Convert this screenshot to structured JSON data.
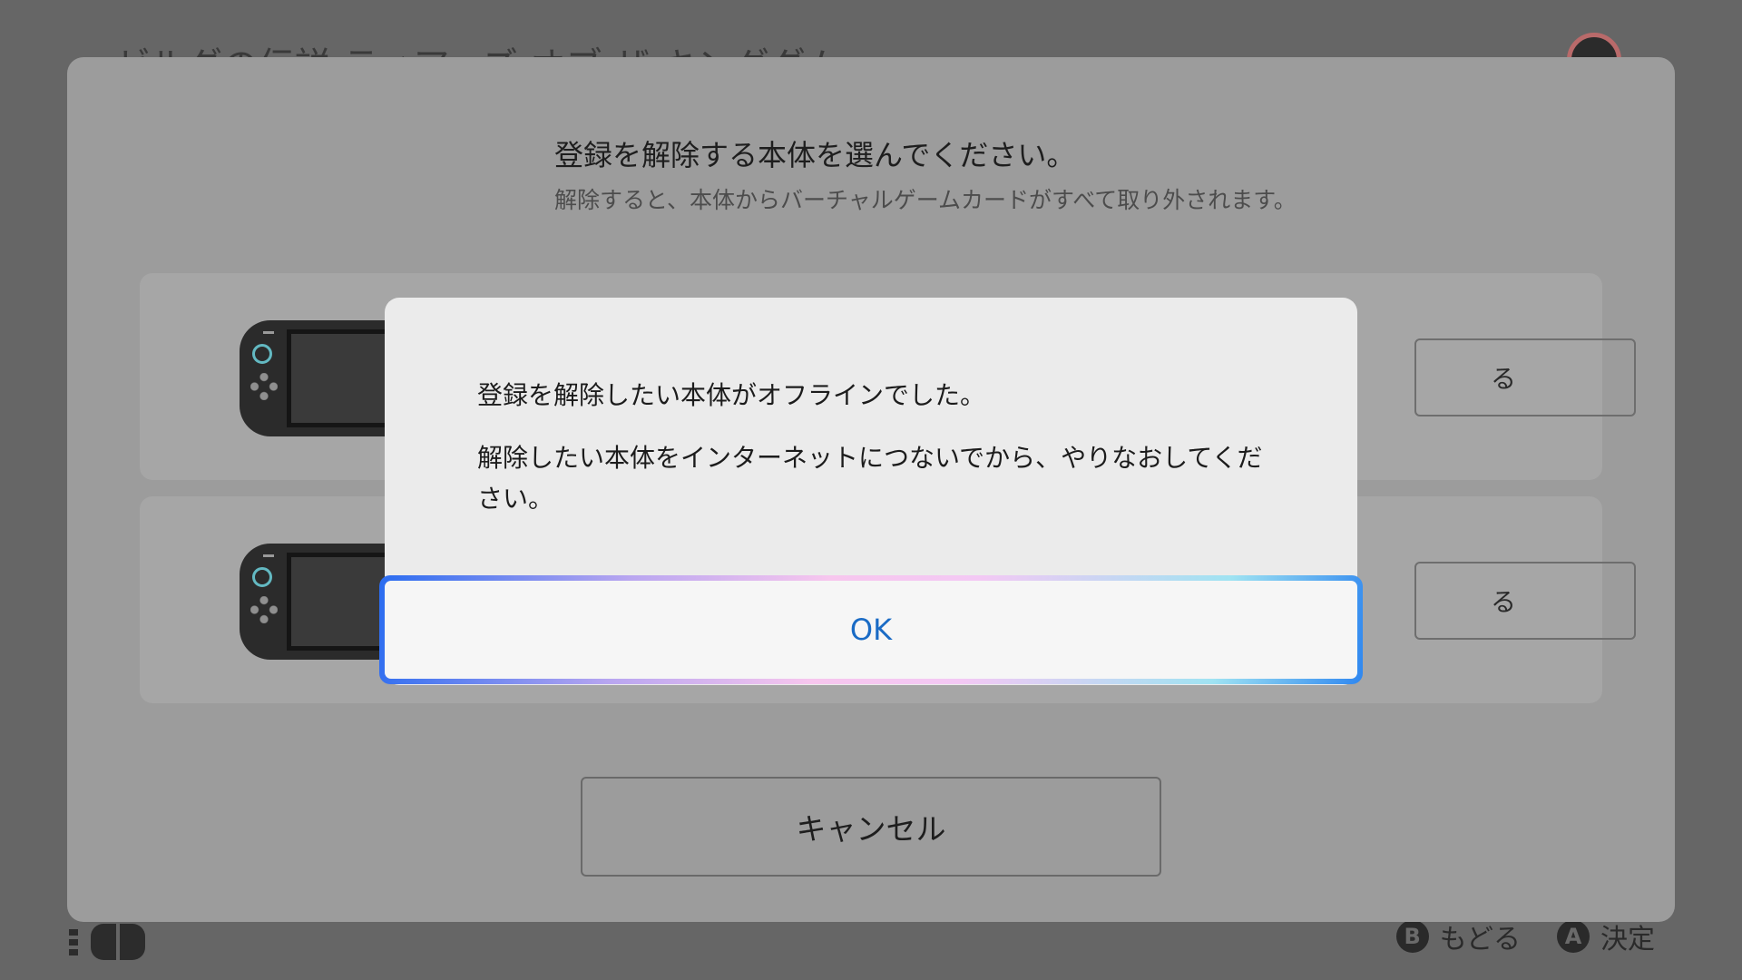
{
  "background": {
    "title": "ゼルダの伝説 ティアーズ オブ ザ キングダム"
  },
  "sheet": {
    "heading": "登録を解除する本体を選んでください。",
    "subheading": "解除すると、本体からバーチャルゲームカードがすべて取り外されます。",
    "device_cards": [
      {
        "button_label_visible": "る"
      },
      {
        "button_label_visible": "る"
      }
    ],
    "cancel_label": "キャンセル"
  },
  "dialog": {
    "line1": "登録を解除したい本体がオフラインでした。",
    "line2": "解除したい本体をインターネットにつないでから、やりなおしてください。",
    "ok_label": "OK"
  },
  "footer": {
    "back_glyph": "B",
    "back_label": "もどる",
    "confirm_glyph": "A",
    "confirm_label": "決定"
  },
  "colors": {
    "ok_text": "#1a6bc5",
    "focus_gradient_start": "#2a6cf0",
    "focus_gradient_end": "#2f87f0",
    "joycon_accent": "#63b9c2"
  }
}
